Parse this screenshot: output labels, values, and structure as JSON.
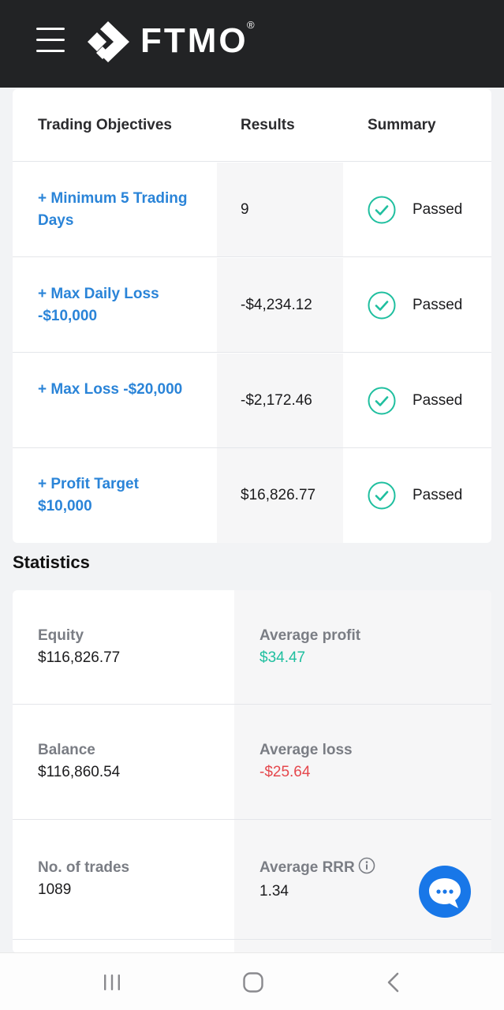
{
  "header": {
    "brand": "FTMO",
    "registered": "®",
    "menu_icon": "hamburger-menu-icon",
    "logo_icon": "ftmo-logo-icon",
    "background": "#222325"
  },
  "objectives": {
    "headers": {
      "objective": "Trading Objectives",
      "results": "Results",
      "summary": "Summary"
    },
    "rows": [
      {
        "objective": "+ Minimum 5 Trading Days",
        "result": "9",
        "status": "Passed"
      },
      {
        "objective": "+ Max Daily Loss -$10,000",
        "result": "-$4,234.12",
        "status": "Passed"
      },
      {
        "objective": "+ Max Loss -$20,000",
        "result": "-$2,172.46",
        "status": "Passed"
      },
      {
        "objective": "+ Profit Target $10,000",
        "result": "$16,826.77",
        "status": "Passed"
      }
    ],
    "link_color": "#2a84d8",
    "check_color": "#1fbf9f"
  },
  "statistics": {
    "title": "Statistics",
    "rows": [
      {
        "left_label": "Equity",
        "left_value": "$116,826.77",
        "right_label": "Average profit",
        "right_value": "$34.47"
      },
      {
        "left_label": "Balance",
        "left_value": "$116,860.54",
        "right_label": "Average loss",
        "right_value": "-$25.64"
      },
      {
        "left_label": "No. of trades",
        "left_value": "1089",
        "right_label": "Average RRR",
        "right_value": "1.34"
      }
    ],
    "positive_color": "#1fbf9f",
    "negative_color": "#e5484d"
  },
  "chat": {
    "icon": "chat-bubble-icon",
    "color": "#1877e8"
  },
  "android_nav": {
    "recents": "recents-icon",
    "home": "home-icon",
    "back": "back-icon"
  }
}
